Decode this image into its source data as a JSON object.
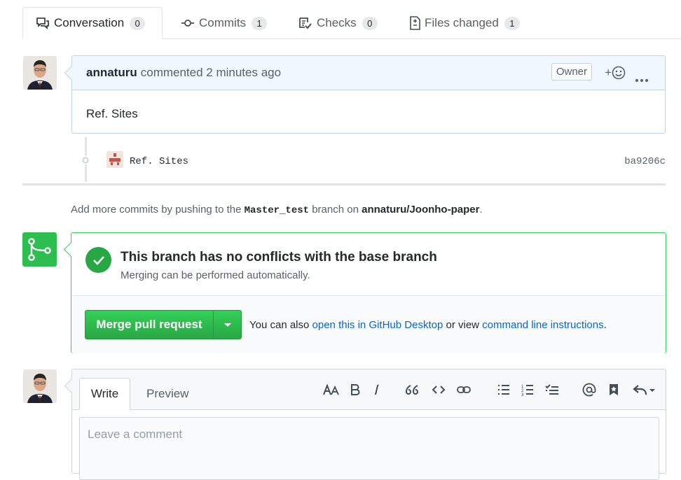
{
  "tabs": [
    {
      "label": "Conversation",
      "count": "0",
      "icon": "comment-discussion-icon"
    },
    {
      "label": "Commits",
      "count": "1",
      "icon": "git-commit-icon"
    },
    {
      "label": "Checks",
      "count": "0",
      "icon": "checklist-icon"
    },
    {
      "label": "Files changed",
      "count": "1",
      "icon": "file-diff-icon"
    }
  ],
  "comment": {
    "author": "annaturu",
    "action": "commented 2 minutes ago",
    "badge": "Owner",
    "reaction_label": "+",
    "body": "Ref. Sites"
  },
  "commit": {
    "message": "Ref. Sites",
    "sha": "ba9206c"
  },
  "hint": {
    "prefix": "Add more commits by pushing to the ",
    "branch": "Master_test",
    "middle": " branch on ",
    "repo": "annaturu/Joonho-paper",
    "suffix": "."
  },
  "merge": {
    "title": "This branch has no conflicts with the base branch",
    "subtitle": "Merging can be performed automatically.",
    "button": "Merge pull request",
    "note_prefix": "You can also ",
    "link_desktop": "open this in GitHub Desktop",
    "note_middle": " or view ",
    "link_cli": "command line instructions",
    "note_suffix": "."
  },
  "editor": {
    "tab_write": "Write",
    "tab_preview": "Preview",
    "placeholder": "Leave a comment",
    "toolbar": [
      "text-size-icon",
      "bold-icon",
      "italic-icon",
      "quote-icon",
      "code-icon",
      "link-icon",
      "unordered-list-icon",
      "ordered-list-icon",
      "task-list-icon",
      "mention-icon",
      "saved-reply-icon",
      "reply-icon"
    ]
  },
  "colors": {
    "accent_green": "#2cbe4e",
    "link_blue": "#0366d6",
    "header_blue": "#f1f8ff"
  }
}
